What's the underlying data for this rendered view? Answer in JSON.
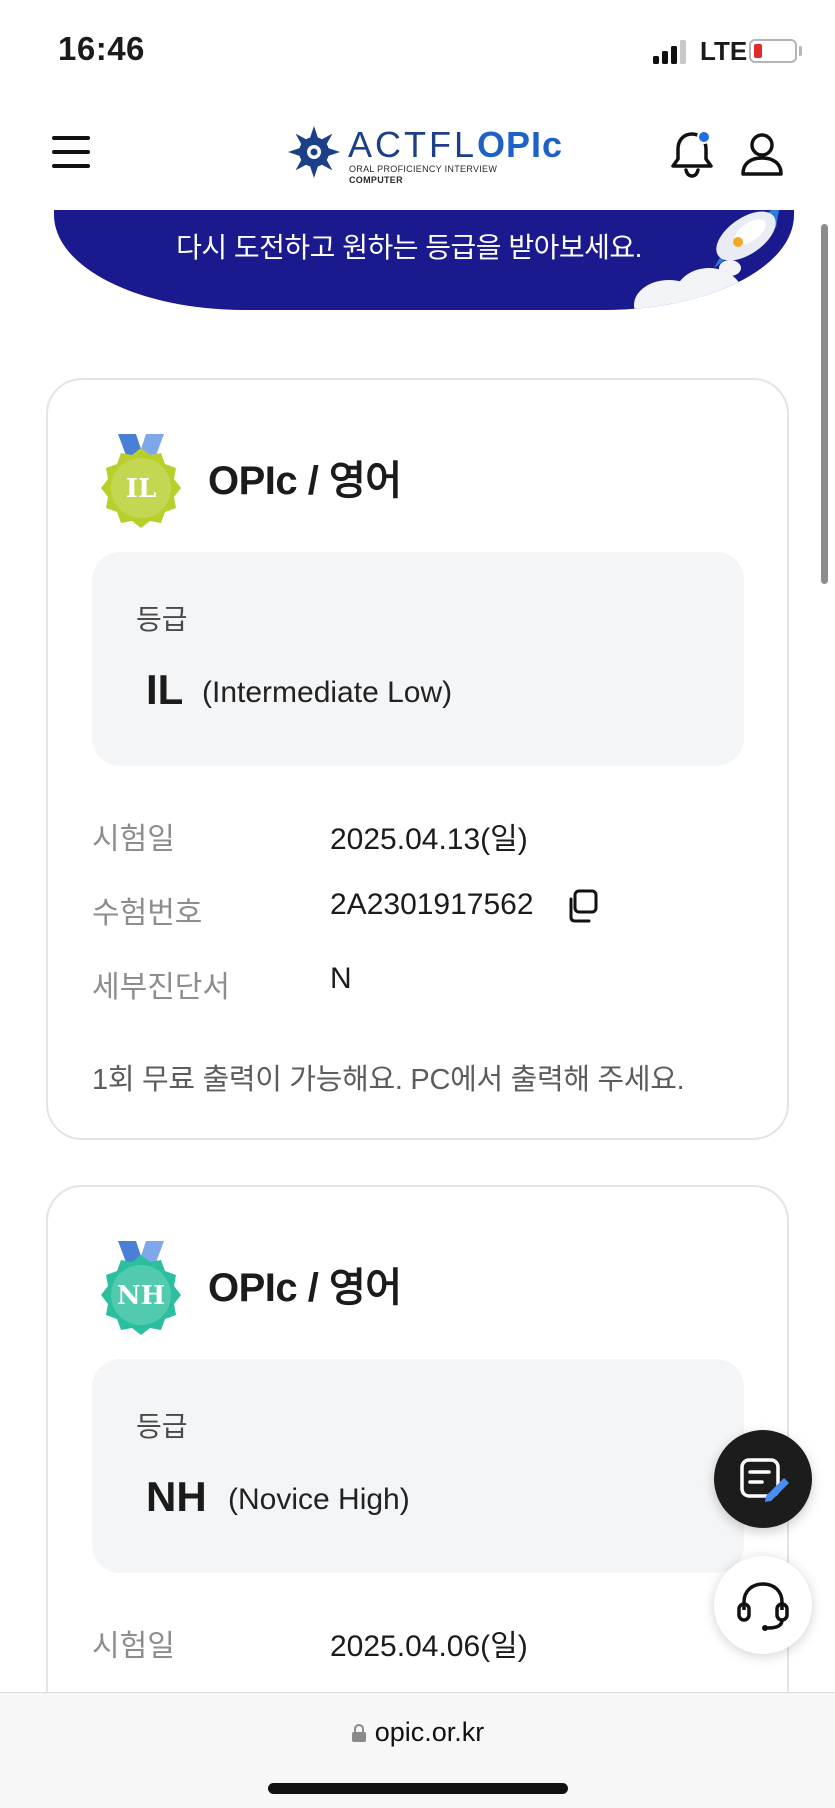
{
  "status_bar": {
    "time": "16:46",
    "network": "LTE"
  },
  "header": {
    "logo": {
      "brand": "ACTFL",
      "product": "OPIc",
      "subtitle_1": "ORAL PROFICIENCY INTERVIEW",
      "subtitle_2": "COMPUTER"
    }
  },
  "banner": {
    "text": "다시 도전하고 원하는 등급을 받아보세요."
  },
  "results": [
    {
      "medal": "IL",
      "medal_color": "#b9cf2c",
      "title": "OPIc / 영어",
      "grade_label": "등급",
      "grade_code": "IL",
      "grade_desc": "(Intermediate Low)",
      "exam_date_label": "시험일",
      "exam_date": "2025.04.13(일)",
      "exam_number_label": "수험번호",
      "exam_number": "2A2301917562",
      "report_label": "세부진단서",
      "report_value": "N",
      "notice": "1회 무료 출력이 가능해요. PC에서 출력해 주세요."
    },
    {
      "medal": "NH",
      "medal_color": "#2bbf9f",
      "title": "OPIc / 영어",
      "grade_label": "등급",
      "grade_code": "NH",
      "grade_desc": "(Novice High)",
      "exam_date_label": "시험일",
      "exam_date": "2025.04.06(일)"
    }
  ],
  "browser": {
    "url": "opic.or.kr"
  },
  "colors": {
    "banner": "#1a1a8e",
    "notification_dot": "#1e6ee8",
    "card_border": "#e2e4e8"
  }
}
